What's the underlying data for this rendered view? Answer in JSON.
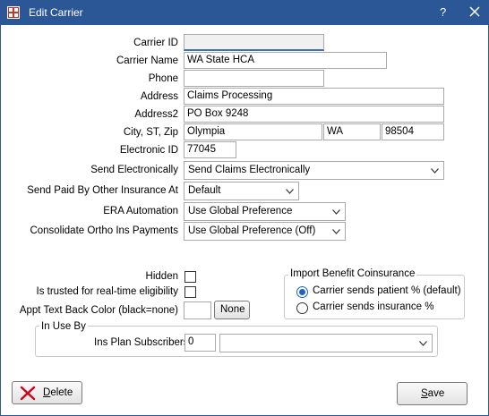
{
  "window": {
    "title": "Edit Carrier",
    "help_label": "?",
    "icons": {
      "app": "grid-app-icon",
      "close": "close-icon"
    },
    "colors": {
      "titlebar": "#2b5797",
      "accent": "#1f63c6"
    }
  },
  "fields": {
    "carrier_id": {
      "label": "Carrier ID",
      "value": ""
    },
    "carrier_name": {
      "label": "Carrier Name",
      "value": "WA State HCA"
    },
    "phone": {
      "label": "Phone",
      "value": ""
    },
    "address": {
      "label": "Address",
      "value": "Claims Processing"
    },
    "address2": {
      "label": "Address2",
      "value": "PO Box 9248"
    },
    "city_st_zip": {
      "label": "City, ST, Zip",
      "city": "Olympia",
      "state": "WA",
      "zip": "98504"
    },
    "electronic_id": {
      "label": "Electronic ID",
      "value": "77045"
    },
    "send_electronically": {
      "label": "Send Electronically",
      "value": "Send Claims Electronically"
    },
    "send_paid_by_other": {
      "label": "Send Paid By Other Insurance At",
      "value": "Default"
    },
    "era_automation": {
      "label": "ERA Automation",
      "value": "Use Global Preference"
    },
    "consolidate_ortho": {
      "label": "Consolidate Ortho Ins Payments",
      "value": "Use Global Preference (Off)"
    }
  },
  "checks": {
    "hidden": {
      "label": "Hidden",
      "checked": false
    },
    "trusted": {
      "label": "Is trusted for real-time eligibility",
      "checked": false
    }
  },
  "appt_color": {
    "label": "Appt Text Back Color (black=none)",
    "button": "None"
  },
  "import_benefit": {
    "title": "Import Benefit Coinsurance",
    "options": [
      {
        "label": "Carrier sends patient % (default)",
        "checked": true
      },
      {
        "label": "Carrier sends insurance %",
        "checked": false
      }
    ]
  },
  "in_use_by": {
    "title": "In Use By",
    "label": "Ins Plan Subscribers",
    "count": "0",
    "selected": ""
  },
  "buttons": {
    "delete": "Delete",
    "save": "Save",
    "delete_icon": "red-x-icon"
  }
}
